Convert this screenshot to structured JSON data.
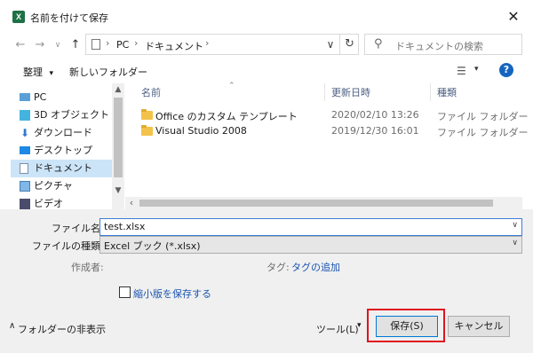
{
  "window": {
    "title": "名前を付けて保存",
    "app_icon_letter": "X"
  },
  "nav": {
    "back": "←",
    "forward": "→",
    "recent": "∨",
    "up": "↑"
  },
  "address": {
    "crumbs": [
      "PC",
      "ドキュメント"
    ],
    "separator": "›",
    "dropdown": "∨",
    "refresh": "↻"
  },
  "search": {
    "placeholder": "ドキュメントの検索"
  },
  "toolbar": {
    "organize_label": "整理",
    "organize_caret": "▾",
    "new_folder_label": "新しいフォルダー",
    "view_caret": "▾",
    "help": "?"
  },
  "sidebar": {
    "items": [
      {
        "label": "PC",
        "icon": "pc-icon"
      },
      {
        "label": "3D オブジェクト",
        "icon": "3d-objects-icon"
      },
      {
        "label": "ダウンロード",
        "icon": "download-icon"
      },
      {
        "label": "デスクトップ",
        "icon": "desktop-icon"
      },
      {
        "label": "ドキュメント",
        "icon": "documents-icon",
        "selected": true
      },
      {
        "label": "ピクチャ",
        "icon": "pictures-icon"
      },
      {
        "label": "ビデオ",
        "icon": "videos-icon"
      }
    ]
  },
  "filelist": {
    "columns": [
      "名前",
      "更新日時",
      "種類"
    ],
    "rows": [
      {
        "name": "Office のカスタム テンプレート",
        "date": "2020/02/10 13:26",
        "type": "ファイル フォルダー"
      },
      {
        "name": "Visual Studio 2008",
        "date": "2019/12/30 16:01",
        "type": "ファイル フォルダー"
      }
    ]
  },
  "form": {
    "filename_label": "ファイル名(N):",
    "filename_value": "test.xlsx",
    "filetype_label": "ファイルの種類(T):",
    "filetype_value": "Excel ブック (*.xlsx)",
    "author_label": "作成者:",
    "tags_label": "タグ:",
    "tags_link": "タグの追加",
    "thumbnail_label": "縮小版を保存する",
    "thumbnail_checked": false
  },
  "footer": {
    "collapse_label": "フォルダーの非表示",
    "collapse_caret": "∧",
    "tools_label": "ツール(L)",
    "tools_caret": "▾",
    "save_label": "保存(S)",
    "cancel_label": "キャンセル"
  },
  "colors": {
    "selected_bg": "#cce4f7",
    "highlight": "#e0141e",
    "link": "#1a55b0"
  }
}
